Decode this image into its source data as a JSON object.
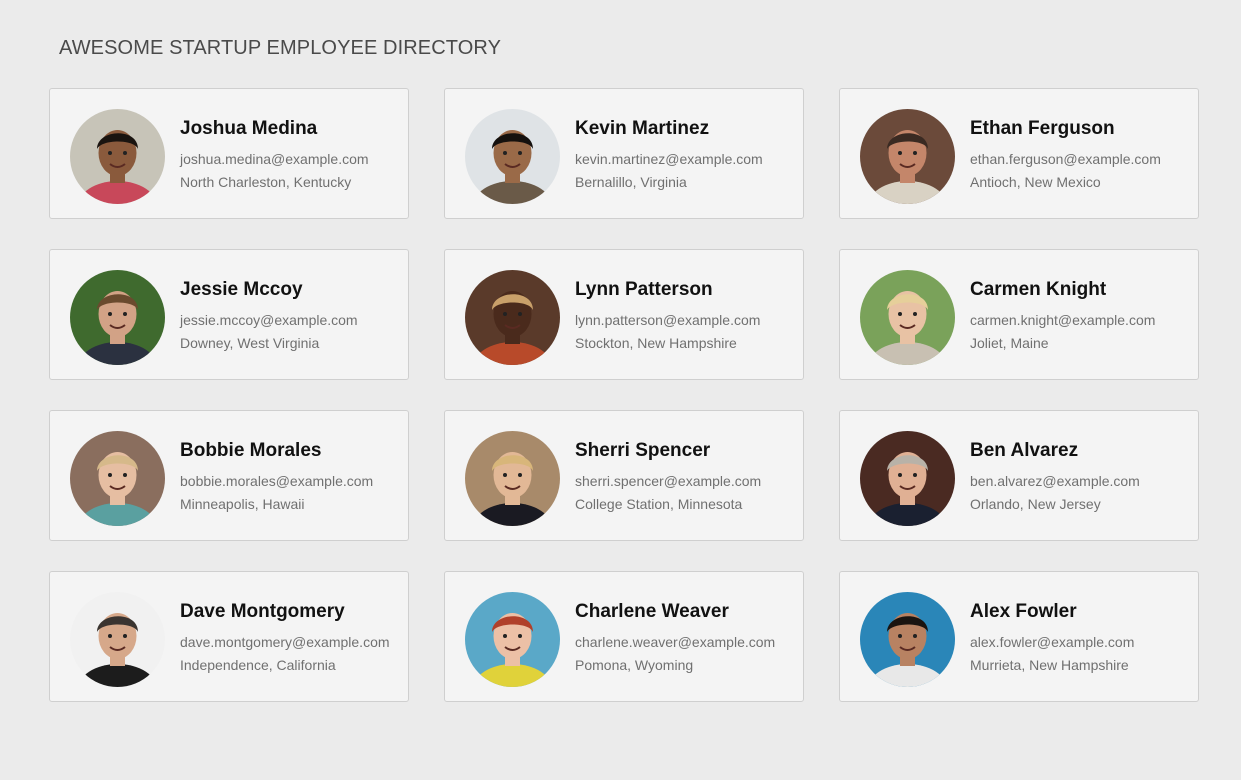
{
  "header": {
    "title": "AWESOME STARTUP EMPLOYEE DIRECTORY"
  },
  "employees": [
    {
      "name": "Joshua Medina",
      "email": "joshua.medina@example.com",
      "location": "North Charleston, Kentucky",
      "avatar": {
        "icon": "person-photo-icon",
        "bg": "#c7c4b8",
        "skin": "#8a5a3c",
        "hair": "#1a1410",
        "shirt": "#c8485a"
      }
    },
    {
      "name": "Kevin Martinez",
      "email": "kevin.martinez@example.com",
      "location": "Bernalillo, Virginia",
      "avatar": {
        "icon": "person-photo-icon",
        "bg": "#dfe3e6",
        "skin": "#9a6a48",
        "hair": "#15110e",
        "shirt": "#6a5a48"
      }
    },
    {
      "name": "Ethan Ferguson",
      "email": "ethan.ferguson@example.com",
      "location": "Antioch, New Mexico",
      "avatar": {
        "icon": "person-photo-icon",
        "bg": "#6b4a3a",
        "skin": "#c4866a",
        "hair": "#3a2a22",
        "shirt": "#d9d2c4"
      }
    },
    {
      "name": "Jessie Mccoy",
      "email": "jessie.mccoy@example.com",
      "location": "Downey, West Virginia",
      "avatar": {
        "icon": "person-photo-icon",
        "bg": "#3f6a2e",
        "skin": "#d2a286",
        "hair": "#6a4a2e",
        "shirt": "#2b3140"
      }
    },
    {
      "name": "Lynn Patterson",
      "email": "lynn.patterson@example.com",
      "location": "Stockton, New Hampshire",
      "avatar": {
        "icon": "person-photo-icon",
        "bg": "#5a3a2a",
        "skin": "#4a2a1c",
        "hair": "#c9a06a",
        "shirt": "#b84a2a"
      }
    },
    {
      "name": "Carmen Knight",
      "email": "carmen.knight@example.com",
      "location": "Joliet, Maine",
      "avatar": {
        "icon": "person-photo-icon",
        "bg": "#7aa25a",
        "skin": "#e8c2a4",
        "hair": "#e6cf9a",
        "shirt": "#c8c0b2"
      }
    },
    {
      "name": "Bobbie Morales",
      "email": "bobbie.morales@example.com",
      "location": "Minneapolis, Hawaii",
      "avatar": {
        "icon": "person-photo-icon",
        "bg": "#8a6e5e",
        "skin": "#e6bea2",
        "hair": "#d6b98a",
        "shirt": "#5aa0a0"
      }
    },
    {
      "name": "Sherri Spencer",
      "email": "sherri.spencer@example.com",
      "location": "College Station, Minnesota",
      "avatar": {
        "icon": "person-photo-icon",
        "bg": "#a88a6a",
        "skin": "#e2b896",
        "hair": "#d8b67a",
        "shirt": "#1a1a22"
      }
    },
    {
      "name": "Ben Alvarez",
      "email": "ben.alvarez@example.com",
      "location": "Orlando, New Jersey",
      "avatar": {
        "icon": "person-photo-icon",
        "bg": "#4a2a22",
        "skin": "#e0b094",
        "hair": "#b8b2a8",
        "shirt": "#1a2030"
      }
    },
    {
      "name": "Dave Montgomery",
      "email": "dave.montgomery@example.com",
      "location": "Independence, California",
      "avatar": {
        "icon": "person-photo-icon",
        "bg": "#f1f1f1",
        "skin": "#d6a88a",
        "hair": "#3a3430",
        "shirt": "#1c1c1c"
      }
    },
    {
      "name": "Charlene Weaver",
      "email": "charlene.weaver@example.com",
      "location": "Pomona, Wyoming",
      "avatar": {
        "icon": "person-photo-icon",
        "bg": "#5aa8c8",
        "skin": "#ecc0a6",
        "hair": "#b0402a",
        "shirt": "#e0d23a"
      }
    },
    {
      "name": "Alex Fowler",
      "email": "alex.fowler@example.com",
      "location": "Murrieta, New Hampshire",
      "avatar": {
        "icon": "person-photo-icon",
        "bg": "#2a86b8",
        "skin": "#b88262",
        "hair": "#1a1410",
        "shirt": "#e8e8e8"
      }
    }
  ]
}
